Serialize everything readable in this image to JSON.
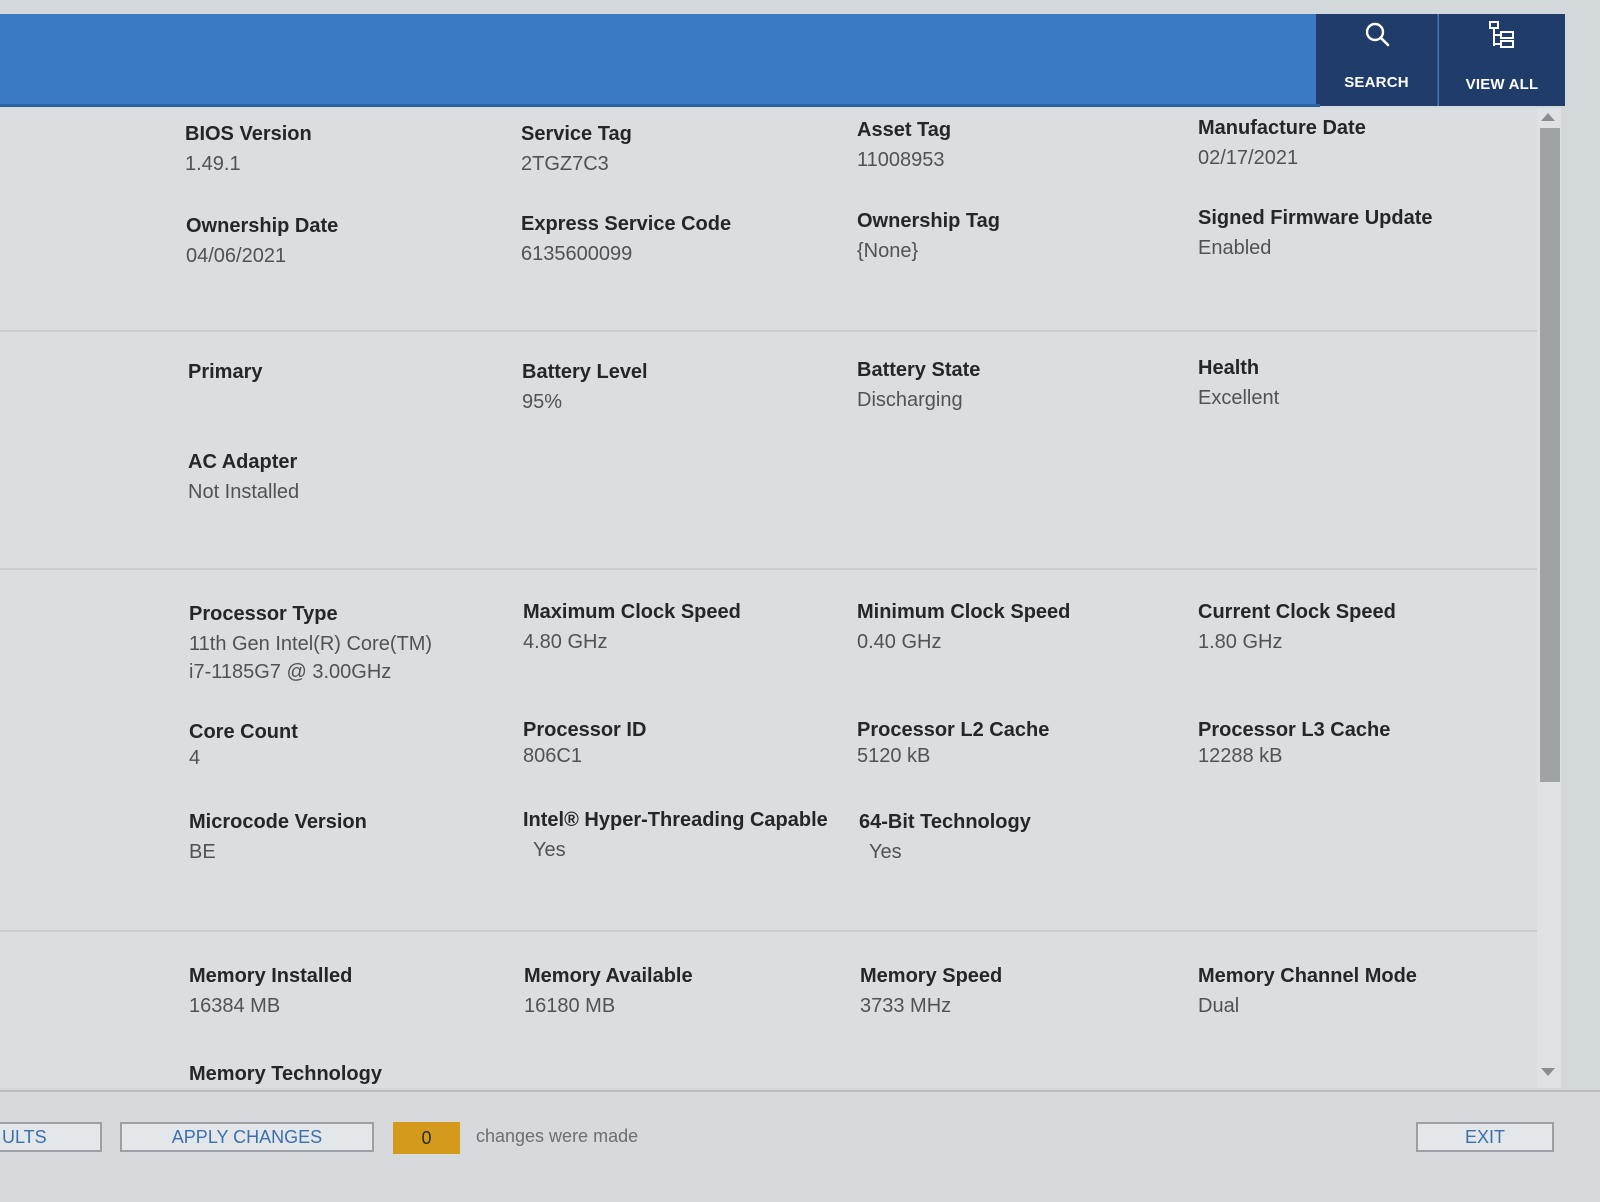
{
  "header": {
    "search_label": "SEARCH",
    "view_all_label": "VIEW ALL"
  },
  "system": {
    "bios_version": {
      "label": "BIOS Version",
      "value": "1.49.1"
    },
    "service_tag": {
      "label": "Service Tag",
      "value": "2TGZ7C3"
    },
    "asset_tag": {
      "label": "Asset Tag",
      "value": "11008953"
    },
    "manufacture_date": {
      "label": "Manufacture Date",
      "value": "02/17/2021"
    },
    "ownership_date": {
      "label": "Ownership Date",
      "value": "04/06/2021"
    },
    "express_service_code": {
      "label": "Express Service Code",
      "value": "6135600099"
    },
    "ownership_tag": {
      "label": "Ownership Tag",
      "value": "{None}"
    },
    "signed_firmware_update": {
      "label": "Signed Firmware Update",
      "value": "Enabled"
    }
  },
  "battery": {
    "primary": {
      "label": "Primary"
    },
    "battery_level": {
      "label": "Battery Level",
      "value": "95%"
    },
    "battery_state": {
      "label": "Battery State",
      "value": "Discharging"
    },
    "health": {
      "label": "Health",
      "value": "Excellent"
    },
    "ac_adapter": {
      "label": "AC Adapter",
      "value": "Not Installed"
    }
  },
  "processor": {
    "processor_type": {
      "label": "Processor Type",
      "value_line1": "11th Gen Intel(R) Core(TM)",
      "value_line2": "i7-1185G7 @ 3.00GHz"
    },
    "max_clock": {
      "label": "Maximum Clock Speed",
      "value": "4.80 GHz"
    },
    "min_clock": {
      "label": "Minimum Clock Speed",
      "value": "0.40 GHz"
    },
    "current_clock": {
      "label": "Current Clock Speed",
      "value": "1.80 GHz"
    },
    "core_count": {
      "label": "Core Count",
      "value": "4"
    },
    "processor_id": {
      "label": "Processor ID",
      "value": "806C1"
    },
    "l2_cache": {
      "label": "Processor L2 Cache",
      "value": "5120 kB"
    },
    "l3_cache": {
      "label": "Processor L3 Cache",
      "value": "12288 kB"
    },
    "microcode": {
      "label": "Microcode Version",
      "value": "BE"
    },
    "hyper_threading": {
      "label": "Intel® Hyper-Threading Capable",
      "value": "Yes"
    },
    "bit64": {
      "label": "64-Bit Technology",
      "value": "Yes"
    }
  },
  "memory": {
    "installed": {
      "label": "Memory Installed",
      "value": "16384 MB"
    },
    "available": {
      "label": "Memory Available",
      "value": "16180 MB"
    },
    "speed": {
      "label": "Memory Speed",
      "value": "3733 MHz"
    },
    "channel_mode": {
      "label": "Memory Channel Mode",
      "value": "Dual"
    },
    "technology": {
      "label": "Memory Technology"
    }
  },
  "footer": {
    "load_defaults_partial": "ULTS",
    "apply_changes": "APPLY CHANGES",
    "changes_count": "0",
    "changes_text": "changes were made",
    "exit": "EXIT"
  },
  "colors": {
    "header_blue": "#3a79c4",
    "header_dark": "#1f3c6a",
    "badge_orange": "#d49a1c",
    "button_text_blue": "#3a6fb0"
  }
}
